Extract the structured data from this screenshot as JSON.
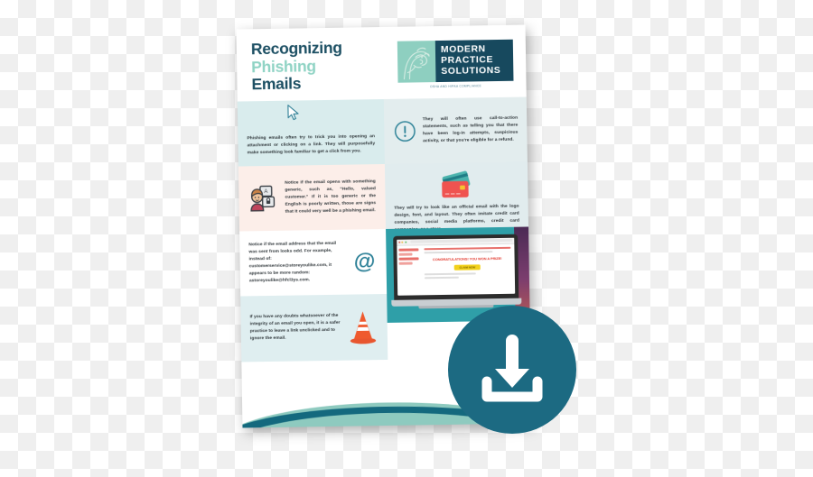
{
  "document": {
    "title_lines": [
      {
        "text": "Recognizing",
        "accent": false
      },
      {
        "text": "Phishing",
        "accent": true
      },
      {
        "text": "Emails",
        "accent": false
      }
    ],
    "logo": {
      "words": [
        "MODERN",
        "PRACTICE",
        "SOLUTIONS"
      ],
      "tagline": "OSHA AND HIPAA COMPLIANCE",
      "mark_color": "#8ecfc0",
      "panel_color": "#17495e"
    },
    "blocks": [
      {
        "id": "trick-you",
        "icon": "cursor-arrow-icon",
        "text": "Phishing emails often try to trick you into opening an attachment or clicking on a link. They will purposefully make something look familiar to get a click from you.",
        "bg": "#d9eced"
      },
      {
        "id": "call-to-action",
        "icon": "exclamation-circle-icon",
        "text": "They will often use call-to-action statements, such as telling you that there have been log-in attempts, suspicious activity, or that you're eligible for a refund.",
        "bg": "#e3edee"
      },
      {
        "id": "generic-greeting",
        "icon": "person-login-icon",
        "text": "Notice if the email opens with something generic, such as, \"Hello, valued customer.\" If it is too generic or the English is poorly written, those are signs that it could very well be a phishing email.",
        "bg": "#fceee9"
      },
      {
        "id": "official-look",
        "icon": "credit-cards-icon",
        "text": "They will try to look like an official email with the logo design, font, and layout. They often imitate credit card companies, social media platforms, credit card companies, or a store.",
        "bg": "#e1ecee"
      },
      {
        "id": "odd-address",
        "icon": "at-sign-icon",
        "text": "Notice if the email address that the email was sent from looks odd. For example, instead of: customerservice@storeyoulike.com, it appears to be more random: astoreyoulike@hfcl3ys.com.",
        "bg": "#ffffff"
      },
      {
        "id": "when-in-doubt",
        "icon": "traffic-cone-icon",
        "text": "If you have any doubts whatsoever of the integrity of an email you open, it is a safer practice to leave a link unclicked and to ignore the email.",
        "bg": "#dfeef0"
      }
    ],
    "laptop": {
      "headline": "CONGRATULATIONS! YOU WON A PRIZE!",
      "button_label": "CLAIM NOW",
      "bg_color": "#2f9fa8"
    },
    "bottom_band": {
      "dark_color": "#14697e",
      "light_color": "#8ecabf"
    }
  },
  "overlay": {
    "download_button": {
      "name": "download-button",
      "icon": "download-arrow-icon",
      "color": "#1c6a82"
    }
  },
  "canvas": {
    "checker_light": "#ffffff",
    "checker_dark": "#efefef"
  }
}
